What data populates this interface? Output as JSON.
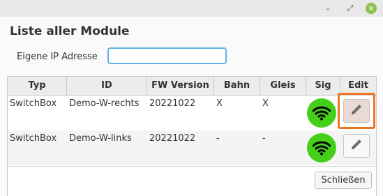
{
  "window": {
    "minimize_glyph": "–",
    "maximize_glyph": "⤢",
    "close_glyph": "✕",
    "close_color": "#8bc34a"
  },
  "dialog": {
    "title": "Liste aller Module",
    "ip_label": "Eigene IP Adresse",
    "ip_value": "",
    "close_label": "Schließen"
  },
  "table": {
    "headers": [
      "Typ",
      "ID",
      "FW Version",
      "Bahn",
      "Gleis",
      "Sig",
      "Edit"
    ],
    "rows": [
      {
        "typ": "SwitchBox",
        "id": "Demo-W-rechts",
        "fw": "20221022",
        "bahn": "X",
        "gleis": "X",
        "sig_icon": "wifi-signal-icon",
        "edit_icon": "pencil-icon"
      },
      {
        "typ": "SwitchBox",
        "id": "Demo-W-links",
        "fw": "20221022",
        "bahn": "-",
        "gleis": "-",
        "sig_icon": "wifi-signal-icon",
        "edit_icon": "pencil-icon"
      }
    ]
  },
  "colors": {
    "signal_ok": "#44d018",
    "highlight": "#ef7521",
    "input_focus": "#5fb4e6"
  }
}
